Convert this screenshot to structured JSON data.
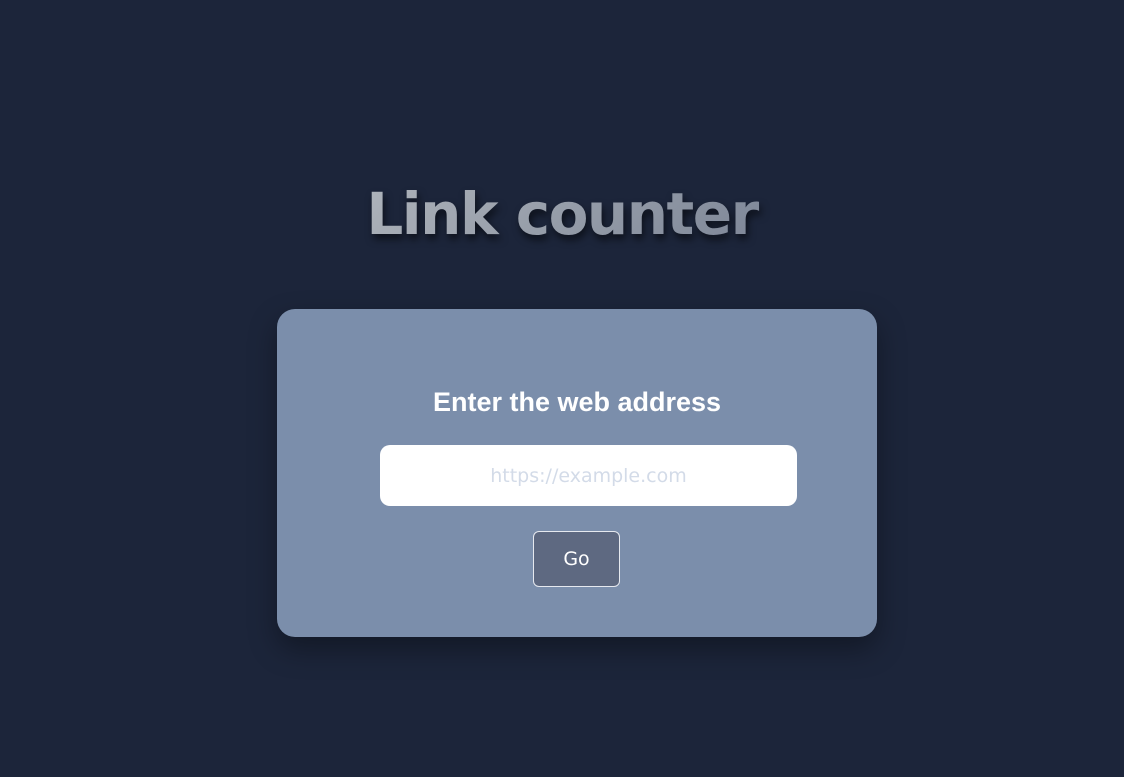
{
  "page": {
    "title": "Link counter"
  },
  "form": {
    "heading": "Enter the web address",
    "url_input": {
      "value": "",
      "placeholder": "https://example.com"
    },
    "submit_label": "Go"
  },
  "colors": {
    "background": "#1c253a",
    "card": "#7b8eab",
    "button": "#5e6981"
  }
}
